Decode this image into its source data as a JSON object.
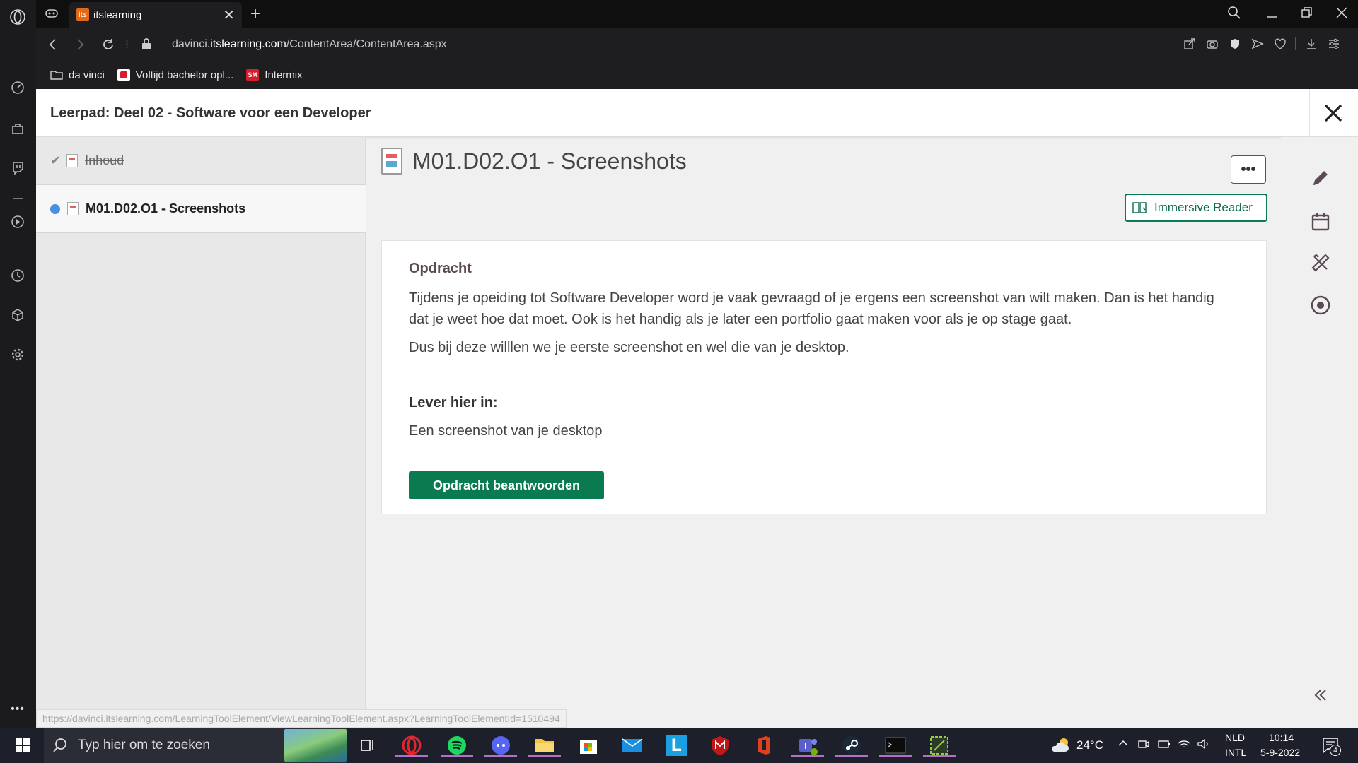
{
  "browser": {
    "tab_title": "itslearning",
    "favicon_text": "its",
    "url_prefix": "davinci.",
    "url_domain": "itslearning.com",
    "url_path": "/ContentArea/ContentArea.aspx",
    "bookmarks": [
      {
        "label": "da vinci",
        "icon": "folder-icon"
      },
      {
        "label": "Voltijd bachelor opl...",
        "icon": "voltijd-favicon"
      },
      {
        "label": "Intermix",
        "icon": "intermix-favicon",
        "icon_text": "SM"
      }
    ],
    "status_url": "https://davinci.itslearning.com/LearningToolElement/ViewLearningToolElement.aspx?LearningToolElementId=1510494"
  },
  "page": {
    "title": "Leerpad: Deel 02 - Software voor een Developer",
    "nav_items": [
      {
        "label": "Inhoud",
        "state": "completed"
      },
      {
        "label": "M01.D02.O1 - Screenshots",
        "state": "current"
      }
    ],
    "content_title": "M01.D02.O1 - Screenshots",
    "more_label": "•••",
    "immersive_reader_label": "Immersive Reader",
    "assignment": {
      "heading": "Opdracht",
      "paragraph1": "Tijdens je opeiding tot Software Developer word je vaak gevraagd of je ergens een screenshot van wilt maken. Dan is het handig dat je weet hoe dat moet. Ook is het handig als je later een portfolio gaat maken voor als je op stage gaat.",
      "paragraph2": "Dus bij deze willlen we je eerste screenshot en wel die van je desktop.",
      "submit_heading": "Lever hier in:",
      "submit_text": "Een screenshot van je desktop",
      "answer_button": "Opdracht beantwoorden"
    }
  },
  "taskbar": {
    "search_placeholder": "Typ hier om te zoeken",
    "temperature": "24°C",
    "lang_top": "NLD",
    "lang_bottom": "INTL",
    "time": "10:14",
    "date": "5-9-2022",
    "notification_count": "4"
  },
  "colors": {
    "accent_green": "#0a7a50",
    "current_dot": "#4a90e2",
    "favicon_orange": "#e06a17"
  }
}
